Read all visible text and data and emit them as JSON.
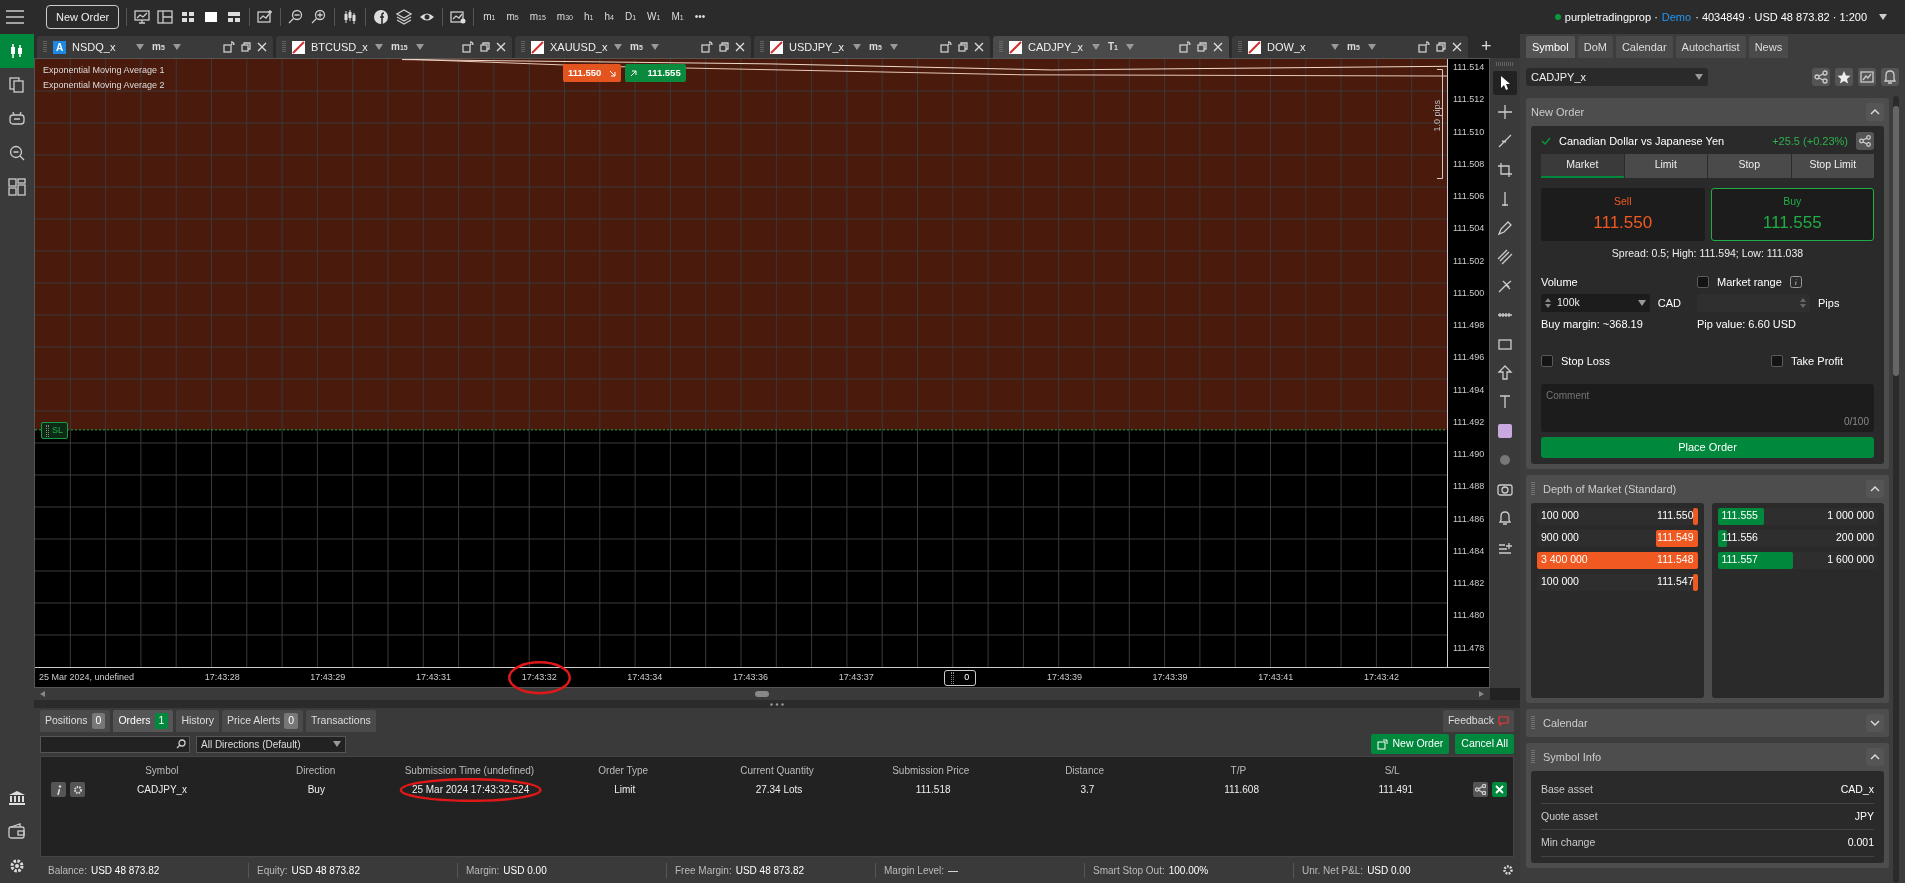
{
  "toolbar": {
    "new_order": "New Order",
    "timeframes": [
      {
        "unit": "m",
        "count": "1"
      },
      {
        "unit": "m",
        "count": "5"
      },
      {
        "unit": "m",
        "count": "15"
      },
      {
        "unit": "m",
        "count": "30"
      },
      {
        "unit": "h",
        "count": "1"
      },
      {
        "unit": "h",
        "count": "4"
      },
      {
        "unit": "D",
        "count": "1"
      },
      {
        "unit": "W",
        "count": "1"
      },
      {
        "unit": "M",
        "count": "1"
      }
    ],
    "more": "•••"
  },
  "account": {
    "prefix": "purpletradingprop ·",
    "mode": "Demo",
    "suffix": "· 4034849 · USD 48 873.82 · 1:200"
  },
  "chart_tabs": [
    {
      "kind": "letter",
      "letter": "A",
      "symbol": "NSDQ_x",
      "unit": "m",
      "count": "5",
      "selected": false
    },
    {
      "kind": "flag",
      "symbol": "BTCUSD_x",
      "unit": "m",
      "count": "15",
      "selected": false
    },
    {
      "kind": "flag",
      "symbol": "XAUUSD_x",
      "unit": "m",
      "count": "5",
      "selected": false
    },
    {
      "kind": "flag",
      "symbol": "USDJPY_x",
      "unit": "m",
      "count": "5",
      "selected": false
    },
    {
      "kind": "flag",
      "symbol": "CADJPY_x",
      "unit": "T",
      "count": "1",
      "selected": true
    },
    {
      "kind": "flag",
      "symbol": "DOW_x",
      "unit": "m",
      "count": "5",
      "selected": false
    }
  ],
  "add_tab": "+",
  "chart": {
    "legend": [
      "Exponential Moving Average 1",
      "Exponential Moving Average 2"
    ],
    "sell_tag": "111.550",
    "buy_tag": "111.555",
    "sl_tag": "SL",
    "pips": "1.0 pips",
    "cursor": "0",
    "price_labels": [
      "111.514",
      "111.512",
      "111.510",
      "111.508",
      "111.506",
      "111.504",
      "111.502",
      "111.500",
      "111.498",
      "111.496",
      "111.494",
      "111.492",
      "111.490",
      "111.488",
      "111.486",
      "111.484",
      "111.482",
      "111.480",
      "111.478"
    ],
    "time_labels": [
      {
        "text": "25 Mar 2024, undefined",
        "circled": false
      },
      {
        "text": "17:43:28",
        "circled": false
      },
      {
        "text": "17:43:29",
        "circled": false
      },
      {
        "text": "17:43:31",
        "circled": false
      },
      {
        "text": "17:43:32",
        "circled": true
      },
      {
        "text": "17:43:34",
        "circled": false
      },
      {
        "text": "17:43:36",
        "circled": false
      },
      {
        "text": "17:43:37",
        "circled": false
      },
      {
        "text": "17:43:39",
        "circled": false
      },
      {
        "text": "17:43:39",
        "circled": false
      },
      {
        "text": "17:43:41",
        "circled": false
      },
      {
        "text": "17:43:42",
        "circled": false
      }
    ]
  },
  "right_tabs": [
    {
      "label": "Symbol",
      "selected": true
    },
    {
      "label": "DoM",
      "selected": false
    },
    {
      "label": "Calendar",
      "selected": false
    },
    {
      "label": "Autochartist",
      "selected": false
    },
    {
      "label": "News",
      "selected": false
    }
  ],
  "symbol_select": "CADJPY_x",
  "new_order": {
    "title": "New Order",
    "expanded": true,
    "instrument": "Canadian Dollar vs Japanese Yen",
    "change": "+25.5 (+0.23%)",
    "order_types": [
      {
        "label": "Market",
        "selected": true
      },
      {
        "label": "Limit",
        "selected": false
      },
      {
        "label": "Stop",
        "selected": false
      },
      {
        "label": "Stop Limit",
        "selected": false
      }
    ],
    "sell": {
      "label": "Sell",
      "price": "111.550",
      "selected": false
    },
    "buy": {
      "label": "Buy",
      "price": "111.555",
      "selected": true
    },
    "spread": "Spread: 0.5; High: 111.594; Low: 111.038",
    "volume_label": "Volume",
    "volume": "100k",
    "currency": "CAD",
    "buy_margin": "Buy margin: ~368.19",
    "market_range": {
      "label": "Market range",
      "checked": false
    },
    "pips": "Pips",
    "pip_value": "Pip value: 6.60 USD",
    "stop_loss": {
      "label": "Stop Loss",
      "checked": false
    },
    "take_profit": {
      "label": "Take Profit",
      "checked": false
    },
    "comment_placeholder": "Comment",
    "comment_counter": "0/100",
    "place_order": "Place Order"
  },
  "dom": {
    "title": "Depth of Market (Standard)",
    "expanded": true,
    "bids": [
      {
        "volume": "100 000",
        "price": "111.550",
        "level": 0.03
      },
      {
        "volume": "900 000",
        "price": "111.549",
        "level": 0.26
      },
      {
        "volume": "3 400 000",
        "price": "111.548",
        "level": 1.0
      },
      {
        "volume": "100 000",
        "price": "111.547",
        "level": 0.03
      }
    ],
    "asks": [
      {
        "price": "111.555",
        "volume": "1 000 000",
        "level": 0.29
      },
      {
        "price": "111.556",
        "volume": "200 000",
        "level": 0.06
      },
      {
        "price": "111.557",
        "volume": "1 600 000",
        "level": 0.47
      }
    ]
  },
  "calendar": {
    "title": "Calendar",
    "expanded": false
  },
  "symbol_info": {
    "title": "Symbol Info",
    "expanded": true,
    "rows": [
      {
        "label": "Base asset",
        "value": "CAD_x"
      },
      {
        "label": "Quote asset",
        "value": "JPY"
      },
      {
        "label": "Min change",
        "value": "0.001"
      }
    ]
  },
  "bottom_tabs": [
    {
      "label": "Positions",
      "count": "0",
      "selected": false
    },
    {
      "label": "Orders",
      "count": "1",
      "selected": true
    },
    {
      "label": "History",
      "selected": false
    },
    {
      "label": "Price Alerts",
      "count": "0",
      "selected": false
    },
    {
      "label": "Transactions",
      "selected": false
    }
  ],
  "feedback": "Feedback",
  "direction_filter": "All Directions (Default)",
  "actions": {
    "new_order": "New Order",
    "cancel_all": "Cancel All"
  },
  "orders": {
    "columns": [
      "Symbol",
      "Direction",
      "Submission Time (undefined)",
      "Order Type",
      "Current Quantity",
      "Submission Price",
      "Distance",
      "T/P",
      "S/L"
    ],
    "rows": [
      {
        "cells": [
          "CADJPY_x",
          "Buy",
          "25 Mar 2024 17:43:32.524",
          "Limit",
          "27.34 Lots",
          "111.518",
          "3.7",
          "111.608",
          "111.491"
        ],
        "circled": true
      }
    ]
  },
  "status_bar": [
    {
      "label": "Balance:",
      "value": "USD 48 873.82"
    },
    {
      "label": "Equity:",
      "value": "USD 48 873.82"
    },
    {
      "label": "Margin:",
      "value": "USD 0.00"
    },
    {
      "label": "Free Margin:",
      "value": "USD 48 873.82"
    },
    {
      "label": "Margin Level:",
      "value": "—"
    },
    {
      "label": "Smart Stop Out:",
      "value": "100.00%"
    },
    {
      "label": "Unr. Net P&L:",
      "value": "USD 0.00"
    }
  ]
}
